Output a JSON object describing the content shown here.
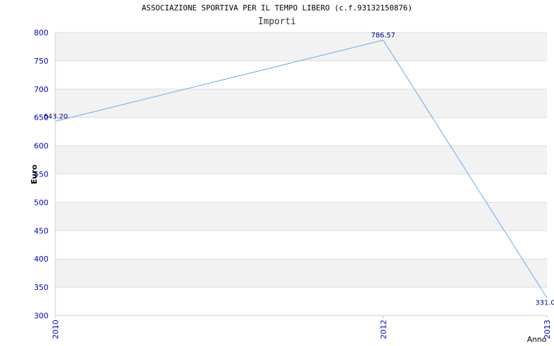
{
  "chart_data": {
    "type": "line",
    "title": "ASSOCIAZIONE SPORTIVA PER IL TEMPO LIBERO (c.f.93132150876)",
    "subtitle": "Importi",
    "xlabel": "Anno",
    "ylabel": "Euro",
    "categories": [
      "2010",
      "2012",
      "2013"
    ],
    "values": [
      643.2,
      786.57,
      331.0
    ],
    "data_labels": [
      "643.20",
      "786.57",
      "331.0"
    ],
    "ylim": [
      300,
      800
    ],
    "yticks": [
      300,
      350,
      400,
      450,
      500,
      550,
      600,
      650,
      700,
      750,
      800
    ],
    "grid": true,
    "colors": {
      "line": "#66aaee",
      "band": "#f2f2f2",
      "grid": "#dddddd",
      "tick": "#0000cc",
      "label": "#00008b"
    }
  }
}
